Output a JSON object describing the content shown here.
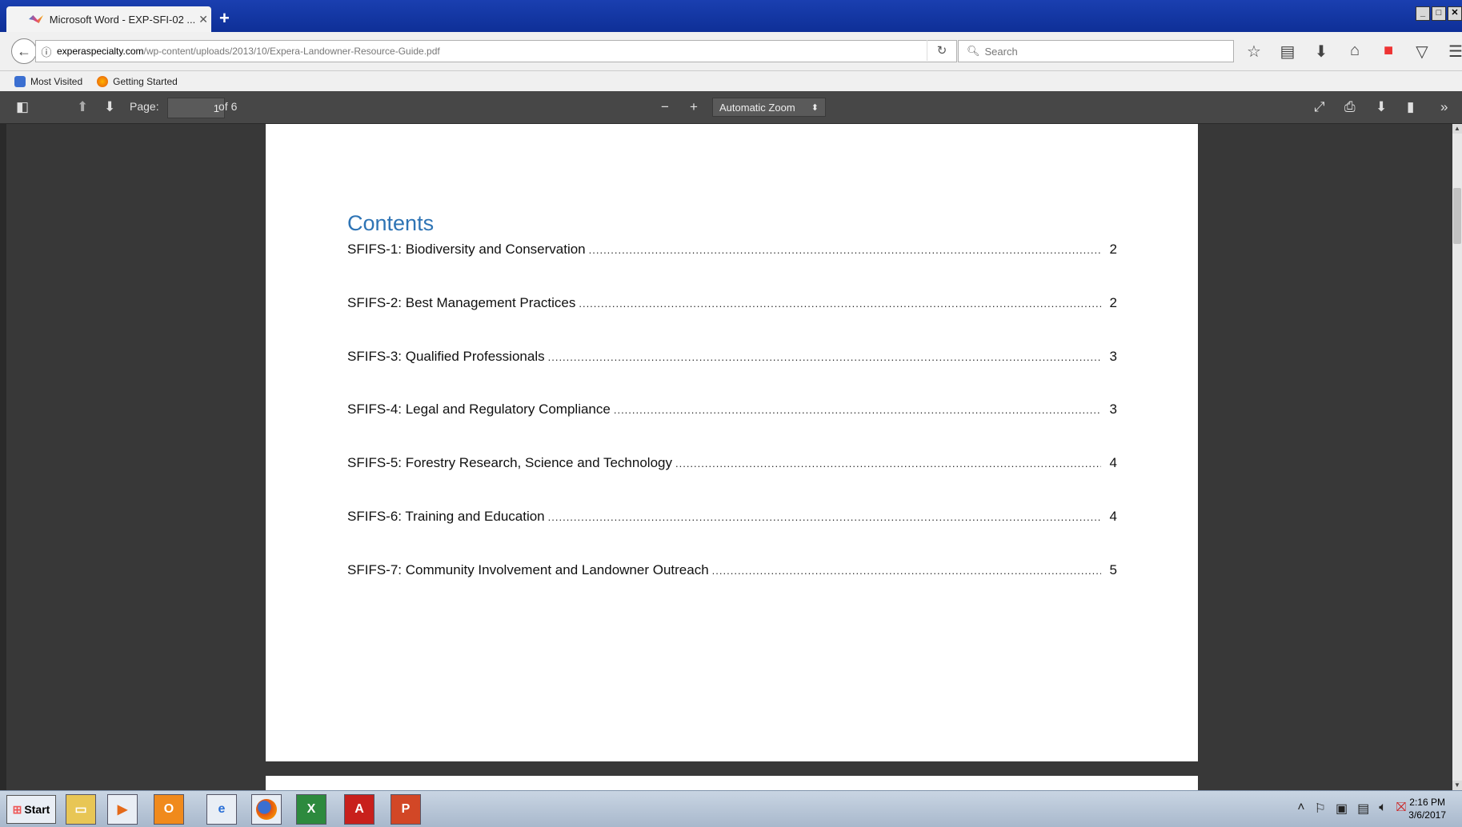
{
  "browser": {
    "tab_title": "Microsoft Word - EXP-SFI-02 ...",
    "url_domain": "experaspecialty.com",
    "url_path": "/wp-content/uploads/2013/10/Expera-Landowner-Resource-Guide.pdf",
    "search_placeholder": "Search",
    "bookmarks": [
      "Most Visited",
      "Getting Started"
    ]
  },
  "pdf_toolbar": {
    "page_label": "Page:",
    "page_current": "1",
    "page_total": "of 6",
    "zoom": "Automatic Zoom"
  },
  "document": {
    "heading": "Contents",
    "toc": [
      {
        "label": "SFIFS-1: Biodiversity and Conservation",
        "page": "2"
      },
      {
        "label": "SFIFS-2: Best Management Practices",
        "page": "2"
      },
      {
        "label": "SFIFS-3: Qualified Professionals",
        "page": "3"
      },
      {
        "label": "SFIFS-4: Legal and Regulatory Compliance",
        "page": "3"
      },
      {
        "label": "SFIFS-5: Forestry Research, Science and Technology",
        "page": "4"
      },
      {
        "label": "SFIFS-6: Training and Education",
        "page": "4"
      },
      {
        "label": "SFIFS-7: Community Involvement and Landowner Outreach",
        "page": "5"
      }
    ]
  },
  "taskbar": {
    "start_label": "Start",
    "clock_time": "2:16 PM",
    "clock_date": "3/6/2017"
  },
  "colors": {
    "heading_blue": "#2e74b5",
    "titlebar_blue": "#1a3fb0",
    "pdf_toolbar": "#474747"
  }
}
